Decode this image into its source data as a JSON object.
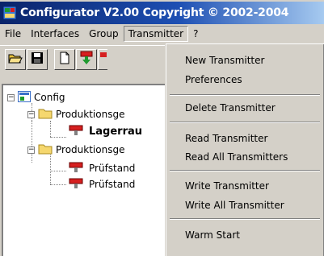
{
  "window": {
    "title": "Configurator  V2.00 Copyright © 2002-2004",
    "app_icon": "configurator-app-icon"
  },
  "menubar": {
    "items": [
      {
        "label": "File"
      },
      {
        "label": "Interfaces"
      },
      {
        "label": "Group"
      },
      {
        "label": "Transmitter",
        "active": true
      },
      {
        "label": "?"
      }
    ]
  },
  "toolbar": {
    "buttons": [
      {
        "icon": "open-folder-icon"
      },
      {
        "icon": "save-disk-icon"
      },
      {
        "icon": "new-document-icon"
      },
      {
        "icon": "read-transmitter-icon"
      },
      {
        "icon": "write-transmitter-icon"
      }
    ]
  },
  "tree": {
    "nodes": [
      {
        "label": "Config",
        "icon": "config-icon",
        "expander": "−"
      },
      {
        "label": "Produktionsge",
        "icon": "folder-icon",
        "expander": "−"
      },
      {
        "label": "Lagerrau",
        "icon": "transmitter-icon",
        "bold": true
      },
      {
        "label": "Produktionsge",
        "icon": "folder-icon",
        "expander": "−"
      },
      {
        "label": "Prüfstand",
        "icon": "transmitter-icon"
      },
      {
        "label": "Prüfstand",
        "icon": "transmitter-icon"
      }
    ]
  },
  "transmitter_menu": {
    "items": [
      {
        "label": "New Transmitter"
      },
      {
        "label": "Preferences"
      },
      {
        "label": "Delete Transmitter"
      },
      {
        "label": "Read Transmitter"
      },
      {
        "label": "Read All Transmitters"
      },
      {
        "label": "Write Transmitter"
      },
      {
        "label": "Write All Transmitter"
      },
      {
        "label": "Warm Start"
      }
    ]
  },
  "colors": {
    "titlebar_start": "#0a246a",
    "titlebar_end": "#a6caf0",
    "face": "#d4d0c8",
    "folder": "#f5d76e",
    "transmitter_red": "#d62020",
    "transmitter_green": "#1f9a2f"
  }
}
